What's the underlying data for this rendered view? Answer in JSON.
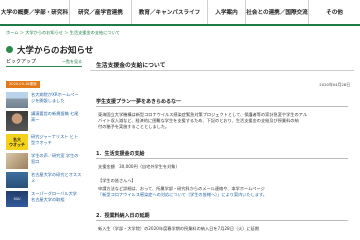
{
  "gnav": {
    "items": [
      "大学の概要／学部・研究科",
      "研究／産学官連携",
      "教育／キャンパスライフ",
      "入学案内",
      "社会との連携／国際交流",
      "その他"
    ]
  },
  "breadcrumb": "ホーム ＞ 大学からのお知らせ ＞ 生活支援金の支給について",
  "page_title": "大学からのお知らせ",
  "sidebar": {
    "title": "ピックアップ",
    "more": "一覧を見る",
    "date": "2020.03.18更新",
    "items": [
      "名大病院がXRホームページを開設しました",
      "講演要旨の新規投稿 七尾高一",
      "研究ジャーナリスト ヒト型ウオッチ",
      "学生の声／研究室 学生の窓口",
      "名古屋大学の研究とオススメ",
      "スーパーグローバル大学 名古屋大学の取組"
    ],
    "watch_text": [
      "名大",
      "ウオッチ"
    ],
    "super_text": "SGU"
  },
  "article": {
    "title": "生活支援金の支給について",
    "date": "2020年04月28日",
    "section0": "学生支援プラン一夢をあきらめるな一",
    "intro": [
      "東海国立大学機構は新型コロナウイルス感染症緊急対策プロジェクトとして、保護者等の家計急変や学生のアル",
      "バイト収入減など、経済的に困難な学生を支援するため、下記のとおり、生活支援金の支給及び授業料の納",
      "付の猶予を実施することとしました。"
    ],
    "section1": "1．生活支援金の支給",
    "amount": "支援金額　30,000円（自宅外学生を対象）",
    "subhead": "【学生の皆さんへ】",
    "apply": [
      "申請方法など詳細は、おって、所属学部・研究科からのメール連絡や、本学ホームページ",
      "「新型コロナウイルス感染症への対応について（学生の皆様へ）」により案内いたします。"
    ],
    "section2": "2．授業料納入日の延期",
    "defer": "新入生（学部・大学院）の2020年度春学期の授業料の納入日を7月28日（火）に延期"
  }
}
